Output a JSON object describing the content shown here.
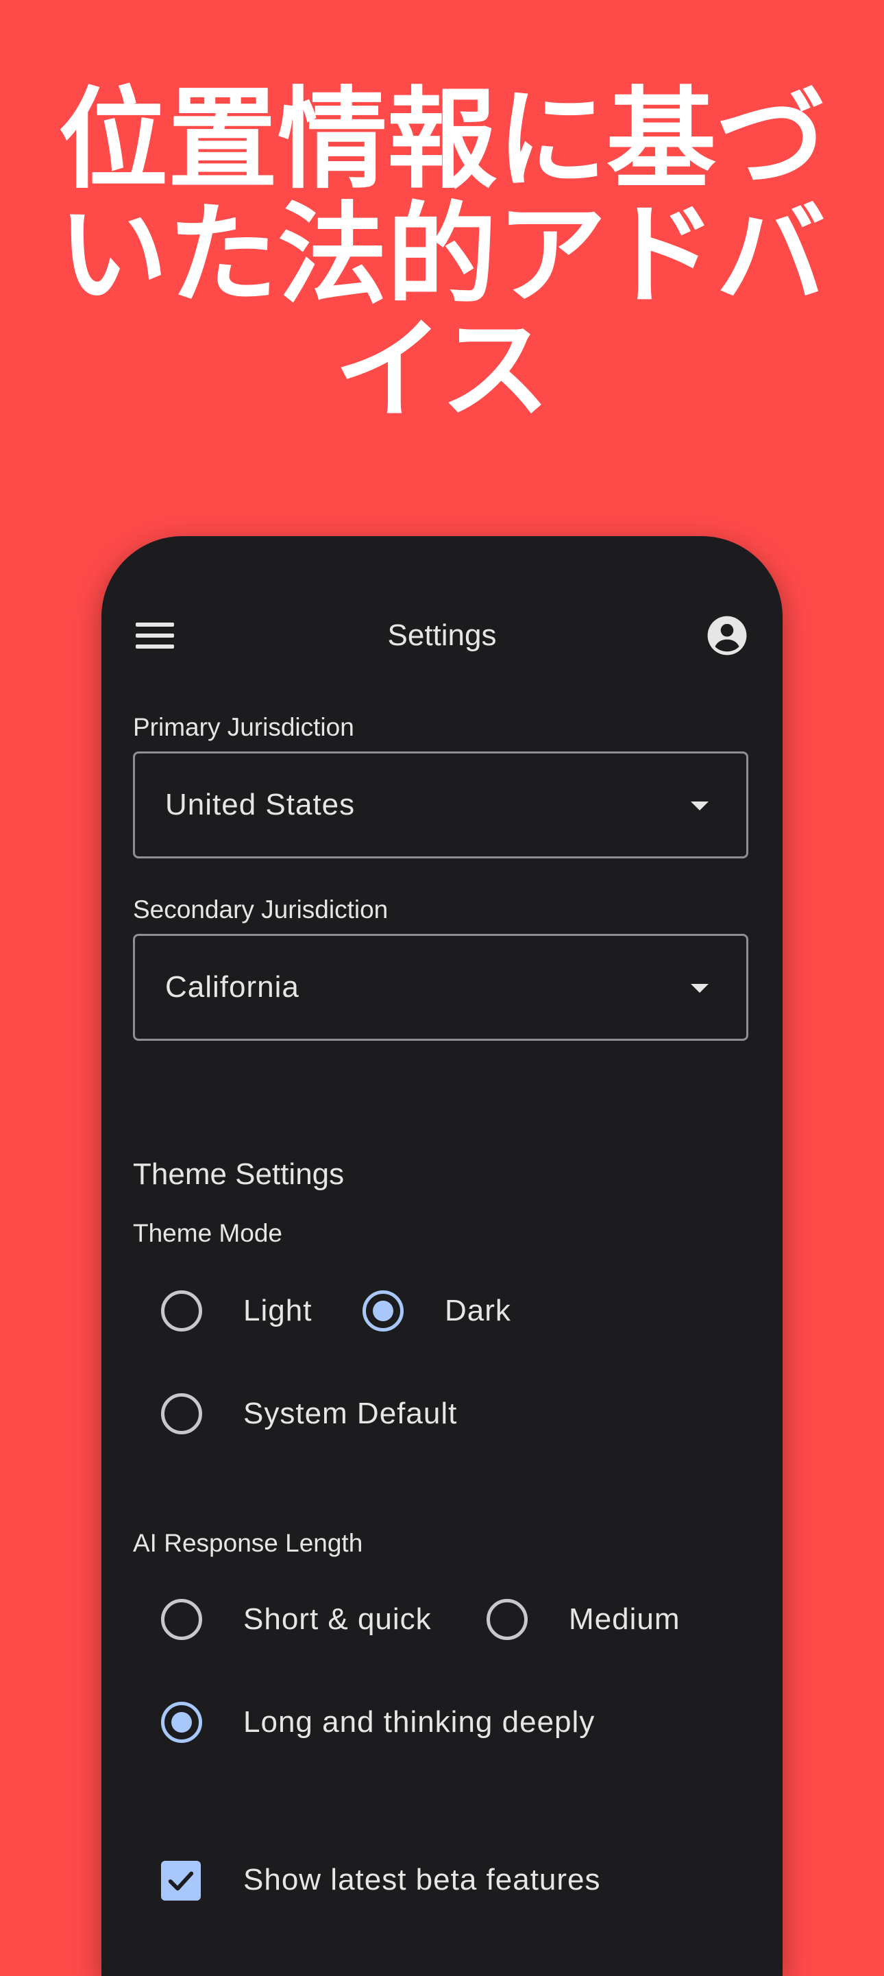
{
  "headline": {
    "line1": "位置情報に基づ",
    "line2": "いた法的アドバ",
    "line3": "イス"
  },
  "app": {
    "title": "Settings",
    "menu_icon": "hamburger-menu-icon",
    "account_icon": "account-circle-icon"
  },
  "jurisdiction": {
    "primary_label": "Primary Jurisdiction",
    "primary_value": "United States",
    "secondary_label": "Secondary Jurisdiction",
    "secondary_value": "California"
  },
  "theme": {
    "section_title": "Theme Settings",
    "mode_label": "Theme Mode",
    "options": [
      {
        "label": "Light",
        "selected": false
      },
      {
        "label": "Dark",
        "selected": true
      },
      {
        "label": "System Default",
        "selected": false
      }
    ]
  },
  "response_length": {
    "label": "AI Response Length",
    "options": [
      {
        "label": "Short & quick",
        "selected": false
      },
      {
        "label": "Medium",
        "selected": false
      },
      {
        "label": "Long and thinking deeply",
        "selected": true
      }
    ]
  },
  "beta": {
    "label": "Show latest beta features",
    "checked": true
  },
  "colors": {
    "background": "#FF4A4A",
    "surface": "#1C1C1E",
    "accent": "#A8C7FA",
    "text": "#E6E6E6"
  }
}
